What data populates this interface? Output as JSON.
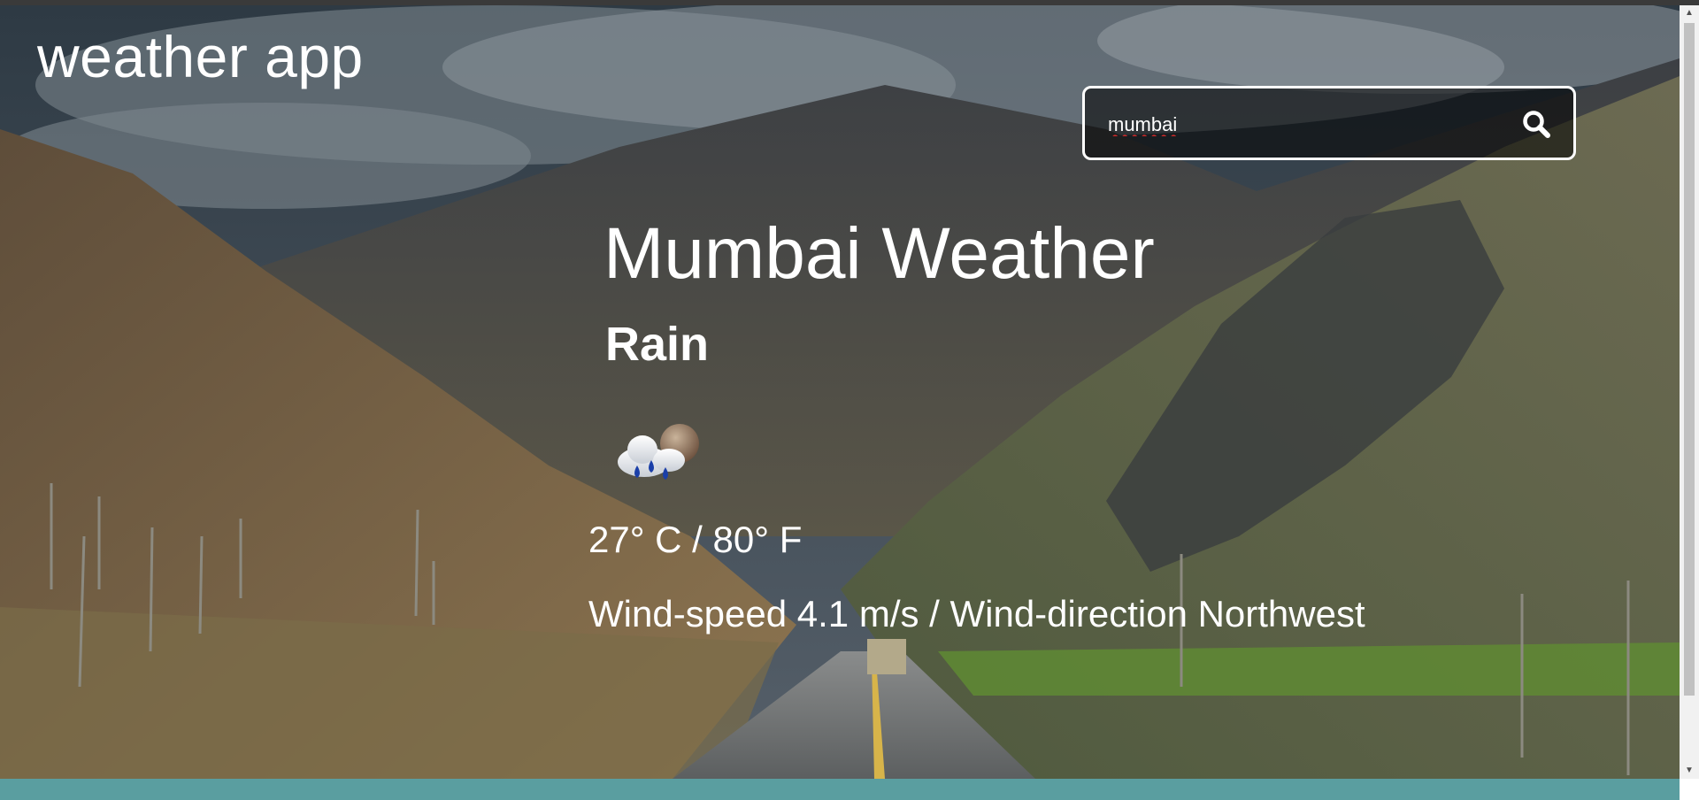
{
  "app": {
    "title": "weather app"
  },
  "search": {
    "value": "mumbai",
    "icon": "search-icon"
  },
  "weather": {
    "heading": "Mumbai Weather",
    "condition": "Rain",
    "icon": "rain-cloud-moon-icon",
    "temperature": "27° C / 80° F",
    "wind": "Wind-speed 4.1 m/s / Wind-direction Northwest"
  },
  "colors": {
    "text": "#ffffff",
    "footer": "#5a9ea0",
    "search_border": "#ffffff"
  }
}
